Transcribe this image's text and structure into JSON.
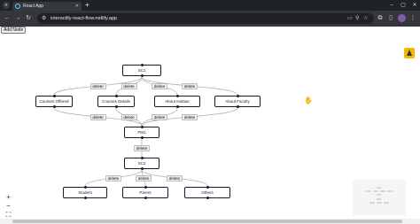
{
  "browser": {
    "tab_title": "React App",
    "url": "interactify-react-flow.netlify.app",
    "new_tab_symbol": "+",
    "icons": [
      "tab-menu-icon",
      "back-icon",
      "forward-icon",
      "reload-icon",
      "cast-icon",
      "zoom-icon",
      "bookmark-star-icon",
      "extensions-icon",
      "side-panel-icon",
      "profile-avatar",
      "more-menu-icon"
    ]
  },
  "app": {
    "add_node_label": "Add Node",
    "delete_label": "delete",
    "accent_color": "#1a192b",
    "extension_badge_color": "#f4b400"
  },
  "flow": {
    "nodes": [
      {
        "id": "sc1",
        "label": "SC1"
      },
      {
        "id": "courses-offered",
        "label": "Courses Offered"
      },
      {
        "id": "courses-details",
        "label": "Courses Details"
      },
      {
        "id": "about-institute",
        "label": "About Institue"
      },
      {
        "id": "about-faculty",
        "label": "About Faculty"
      },
      {
        "id": "fm1",
        "label": "FM1"
      },
      {
        "id": "sc2",
        "label": "SC2"
      },
      {
        "id": "student",
        "label": "Student"
      },
      {
        "id": "parent",
        "label": "Parent"
      },
      {
        "id": "others",
        "label": "Others"
      }
    ],
    "edges": [
      {
        "source": "sc1",
        "target": "courses-offered"
      },
      {
        "source": "sc1",
        "target": "courses-details"
      },
      {
        "source": "sc1",
        "target": "about-institute"
      },
      {
        "source": "sc1",
        "target": "about-faculty"
      },
      {
        "source": "courses-offered",
        "target": "fm1"
      },
      {
        "source": "courses-details",
        "target": "fm1"
      },
      {
        "source": "about-institute",
        "target": "fm1"
      },
      {
        "source": "about-faculty",
        "target": "fm1"
      },
      {
        "source": "fm1",
        "target": "sc2"
      },
      {
        "source": "sc2",
        "target": "student"
      },
      {
        "source": "sc2",
        "target": "parent"
      },
      {
        "source": "sc2",
        "target": "others"
      }
    ]
  },
  "controls": {
    "zoom_in": "+",
    "zoom_out": "−",
    "fit_view": "⛶"
  }
}
